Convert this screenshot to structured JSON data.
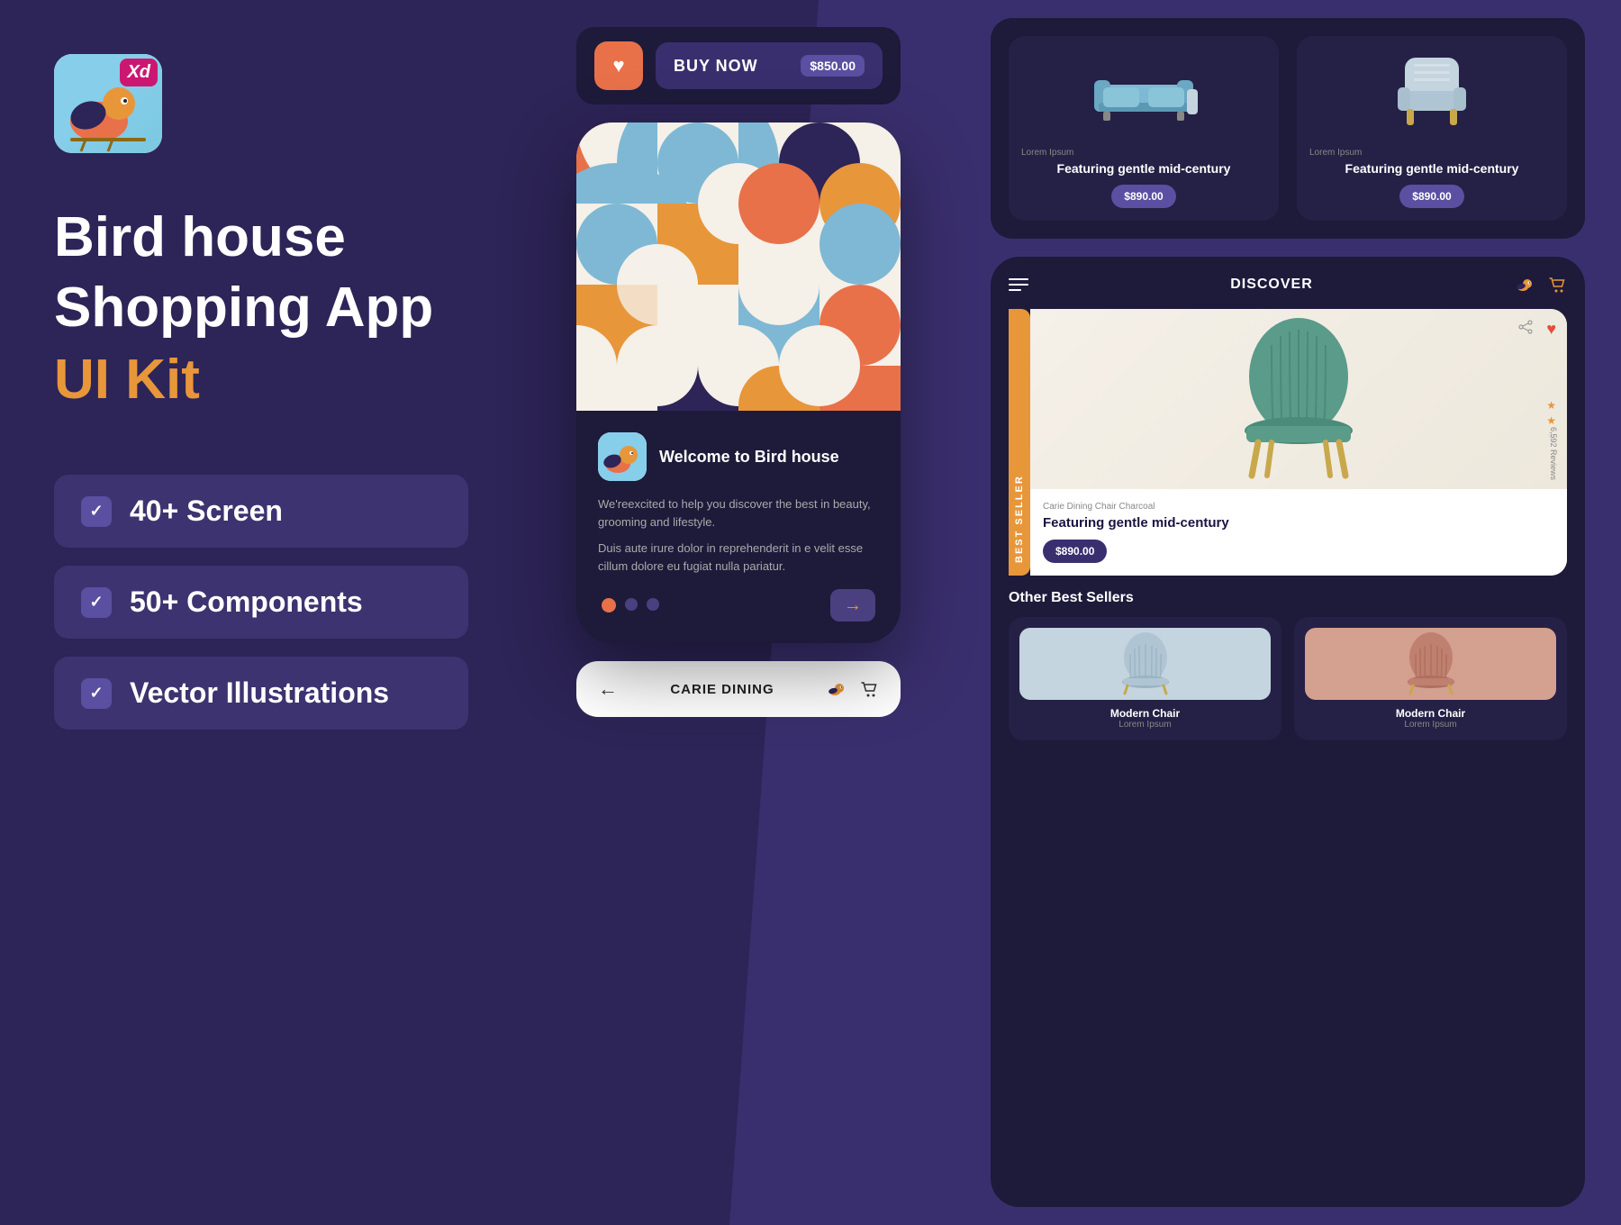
{
  "app": {
    "xd_label": "Xd",
    "title_line1": "Bird house",
    "title_line2": "Shopping App",
    "title_line3": "UI Kit"
  },
  "features": [
    {
      "id": "screens",
      "label": "40+ Screen"
    },
    {
      "id": "components",
      "label": "50+ Components"
    },
    {
      "id": "illustrations",
      "label": "Vector Illustrations"
    }
  ],
  "buy_bar": {
    "heart": "♥",
    "button_text": "BUY NOW",
    "price": "$850.00"
  },
  "welcome": {
    "title": "Welcome to Bird house",
    "body1": "We'reexcited to help you discover the best in beauty, grooming and lifestyle.",
    "body2": "Duis aute irure dolor in reprehenderit in e velit esse cillum dolore eu fugiat nulla pariatur."
  },
  "discover": {
    "title": "DISCOVER"
  },
  "best_seller": {
    "tag": "BEST SELLER",
    "brand": "Carie Dining Chair Charcoal",
    "title": "Featuring gentle mid-century",
    "price": "$890.00",
    "reviews": "6,592 Reviews"
  },
  "top_products": [
    {
      "lorem": "Lorem Ipsum",
      "title": "Featuring gentle mid-century",
      "price": "$890.00"
    },
    {
      "lorem": "Lorem Ipsum",
      "title": "Featuring gentle mid-century",
      "price": "$890.00"
    }
  ],
  "other_sellers": {
    "title": "Other Best Sellers",
    "items": [
      {
        "title": "Modern Chair",
        "sub": "Lorem Ipsum"
      },
      {
        "title": "Modern Chair",
        "sub": "Lorem Ipsum"
      }
    ]
  },
  "carie_bar": {
    "title": "CARIE DINING"
  }
}
